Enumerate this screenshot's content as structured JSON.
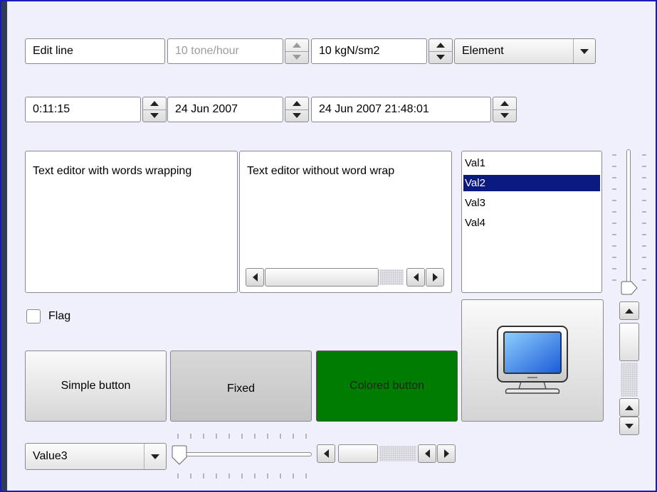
{
  "row1": {
    "edit_line": "Edit line",
    "rate_field": "10 tone/hour",
    "pressure_field": "10 kgN/sm2",
    "element_combo": "Element"
  },
  "row2": {
    "time_field": "0:11:15",
    "date_field": "24 Jun 2007",
    "datetime_field": "24 Jun 2007 21:48:01"
  },
  "text_editors": {
    "wrap": "Text editor with words wrapping",
    "nowrap": "Text editor without word wrap"
  },
  "list": {
    "items": [
      "Val1",
      "Val2",
      "Val3",
      "Val4"
    ],
    "selected": "Val2"
  },
  "checkbox": {
    "label": "Flag",
    "checked": false
  },
  "buttons": {
    "simple": "Simple button",
    "fixed": "Fixed",
    "colored": "Colored button",
    "colored_bg": "#007c00"
  },
  "bottom_combo": {
    "value": "Value3"
  },
  "icons": [
    "spin-up-icon",
    "spin-down-icon",
    "dropdown-arrow-icon",
    "scroll-left-icon",
    "scroll-right-icon",
    "scroll-up-icon",
    "scroll-down-icon",
    "monitor-icon",
    "slider-handle-icon"
  ],
  "colors": {
    "selection": "#0a1a80",
    "frame_border": "#1a1ab8",
    "window_bg": "#f0f0fc"
  }
}
